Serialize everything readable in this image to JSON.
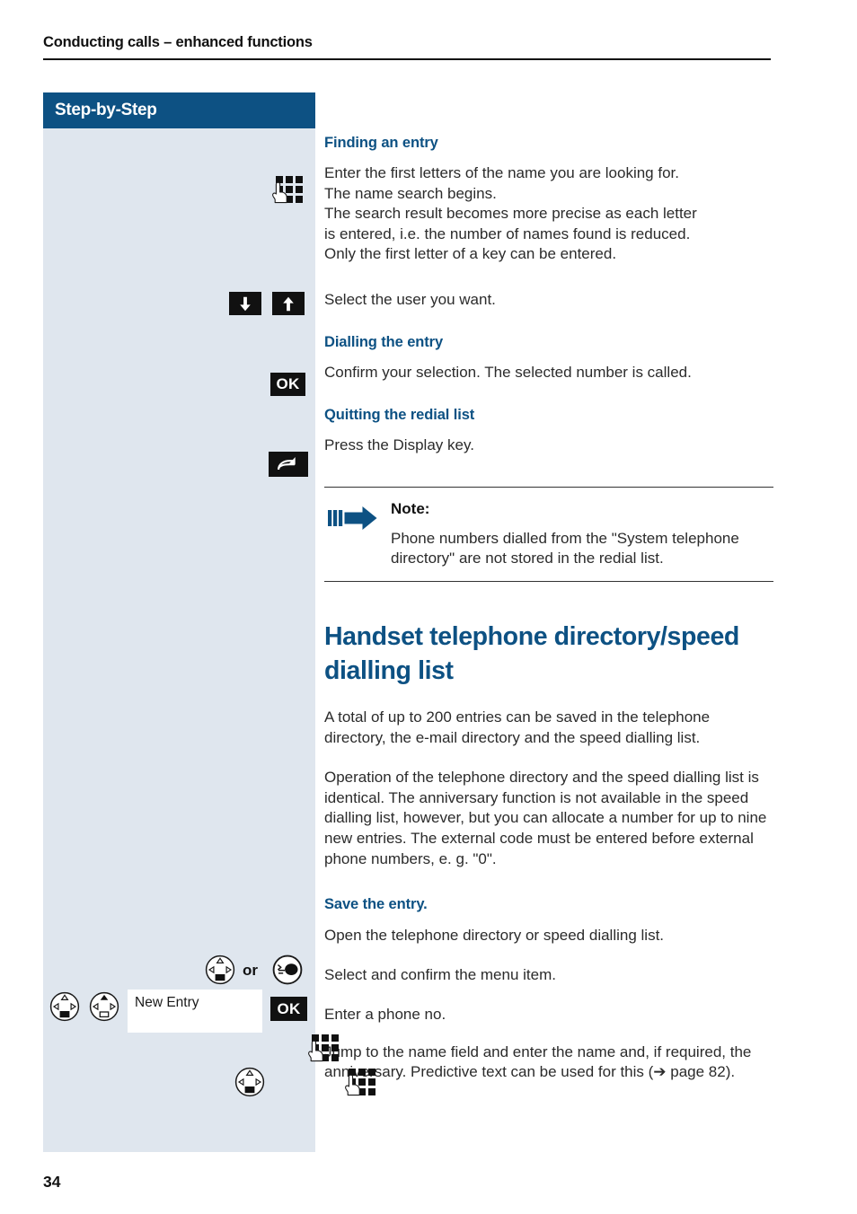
{
  "header": {
    "title": "Conducting calls – enhanced functions"
  },
  "sidebar": {
    "title": "Step-by-Step"
  },
  "page_number": "34",
  "sections": [
    {
      "heading": "Finding an entry",
      "icon": "keypad-hand-icon",
      "text": "Enter the first letters of the name you are looking for. The name search begins.\nThe search result becomes more precise as each letter is entered, i.e. the number of names found is reduced. Only the first letter of a key can be entered."
    },
    {
      "heading": "",
      "icon": "down-arrow-key, up-arrow-key",
      "text": "Select the user you want."
    },
    {
      "heading": "Dialling the entry",
      "icon": "ok-key",
      "text": "Confirm your selection. The selected number is called."
    },
    {
      "heading": "Quitting the redial list",
      "icon": "return-key",
      "text": "Press the Display key."
    }
  ],
  "steps": {
    "finding_heading": "Finding an entry",
    "finding_line1": "Enter the first letters of the name you are looking for.",
    "finding_line2": "The name search begins.",
    "finding_line3": "The search result becomes more precise as each letter",
    "finding_line4": "is entered, i.e. the number of names found is reduced.",
    "finding_line5": "Only the first letter of a key can be entered.",
    "select_user": "Select the user you want.",
    "dialling_heading": "Dialling the entry",
    "dialling_text": "Confirm your selection. The selected number is called.",
    "quitting_heading": "Quitting the redial list",
    "quitting_text": "Press the Display key."
  },
  "note": {
    "title": "Note:",
    "text": "Phone numbers dialled from the \"System telephone directory\" are not stored in the redial list."
  },
  "chapter": {
    "title": "Handset telephone directory/speed dialling list",
    "paragraph1": "A total of up to 200 entries can be saved in the telephone directory, the e-mail directory and the speed dialling list.",
    "paragraph2": "Operation of the telephone directory and the speed dialling list is identical. The anniversary function is not available in the speed dialling list, however, but you can allocate a number for up to nine new entries. The external code must be entered before external phone numbers, e. g. \"0\"."
  },
  "save_entry": {
    "heading": "Save the entry.",
    "open_directory": "Open the telephone directory or speed dialling list.",
    "select_confirm": "Select and confirm the menu item.",
    "enter_phone": "Enter a phone no.",
    "jump_name_field": "Jump to the name field and enter the name and, if required, the anniversary. Predictive text can be used for this (➔ page 82).",
    "or_label": "or",
    "display_value": "New Entry",
    "ok_label": "OK"
  },
  "keys": {
    "ok": "OK"
  },
  "colors": {
    "brand_blue": "#0d5183",
    "sidebar_bg": "#dfe6ee",
    "key_black": "#111111",
    "text": "#2b2b2b"
  }
}
